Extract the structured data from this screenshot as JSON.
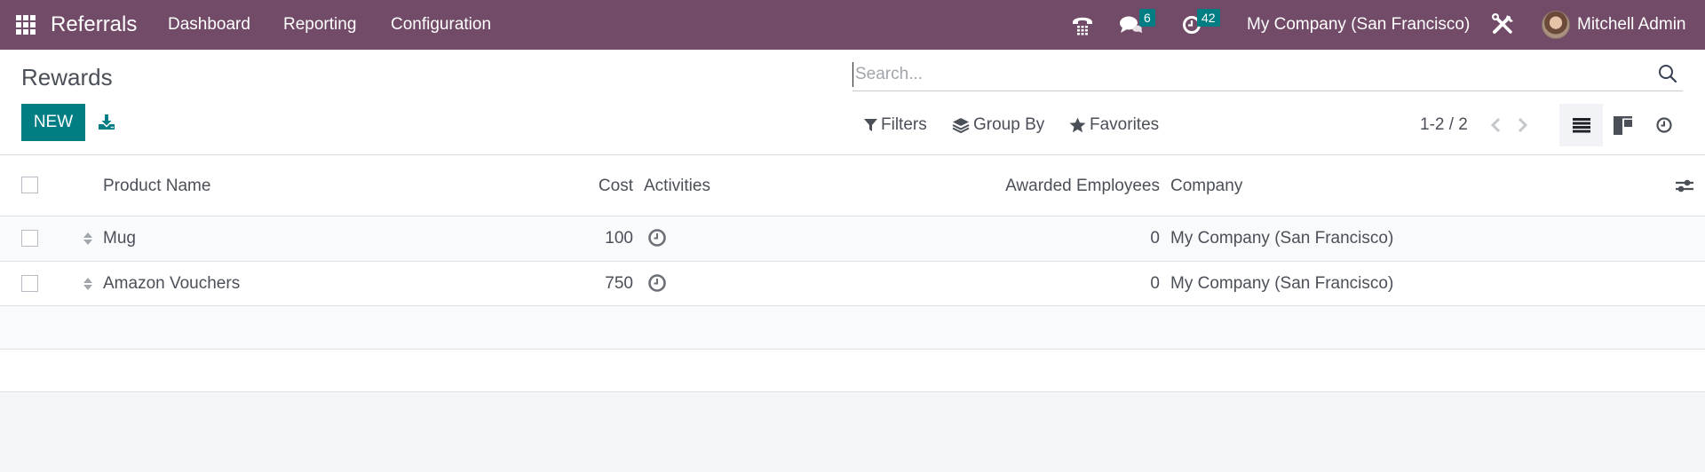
{
  "navbar": {
    "app_name": "Referrals",
    "menu": [
      {
        "label": "Dashboard"
      },
      {
        "label": "Reporting"
      },
      {
        "label": "Configuration"
      }
    ],
    "systray": {
      "phone_icon": "phone-icon",
      "messages_icon": "chat-bubbles-icon",
      "messages_count": "6",
      "activities_icon": "clock-icon",
      "activities_count": "42",
      "company": "My Company (San Francisco)",
      "debug_icon": "tools-icon",
      "user_name": "Mitchell Admin"
    },
    "colors": {
      "background": "#714b67",
      "badge": "#017e84"
    }
  },
  "control_panel": {
    "title": "Rewards",
    "new_label": "NEW",
    "download_icon": "download-icon",
    "search": {
      "placeholder": "Search...",
      "value": ""
    },
    "filters_label": "Filters",
    "group_by_label": "Group By",
    "favorites_label": "Favorites",
    "pager": "1-2 / 2",
    "views": [
      {
        "name": "list",
        "icon": "list-view-icon",
        "active": true
      },
      {
        "name": "kanban",
        "icon": "kanban-view-icon",
        "active": false
      },
      {
        "name": "activity",
        "icon": "activity-view-icon",
        "active": false
      }
    ],
    "colors": {
      "primary": "#017e84"
    }
  },
  "table": {
    "columns": {
      "product_name": "Product Name",
      "cost": "Cost",
      "activities": "Activities",
      "awarded_employees": "Awarded Employees",
      "company": "Company"
    },
    "rows": [
      {
        "product_name": "Mug",
        "cost": "100",
        "awarded_employees": "0",
        "company": "My Company (San Francisco)"
      },
      {
        "product_name": "Amazon Vouchers",
        "cost": "750",
        "awarded_employees": "0",
        "company": "My Company (San Francisco)"
      }
    ]
  }
}
